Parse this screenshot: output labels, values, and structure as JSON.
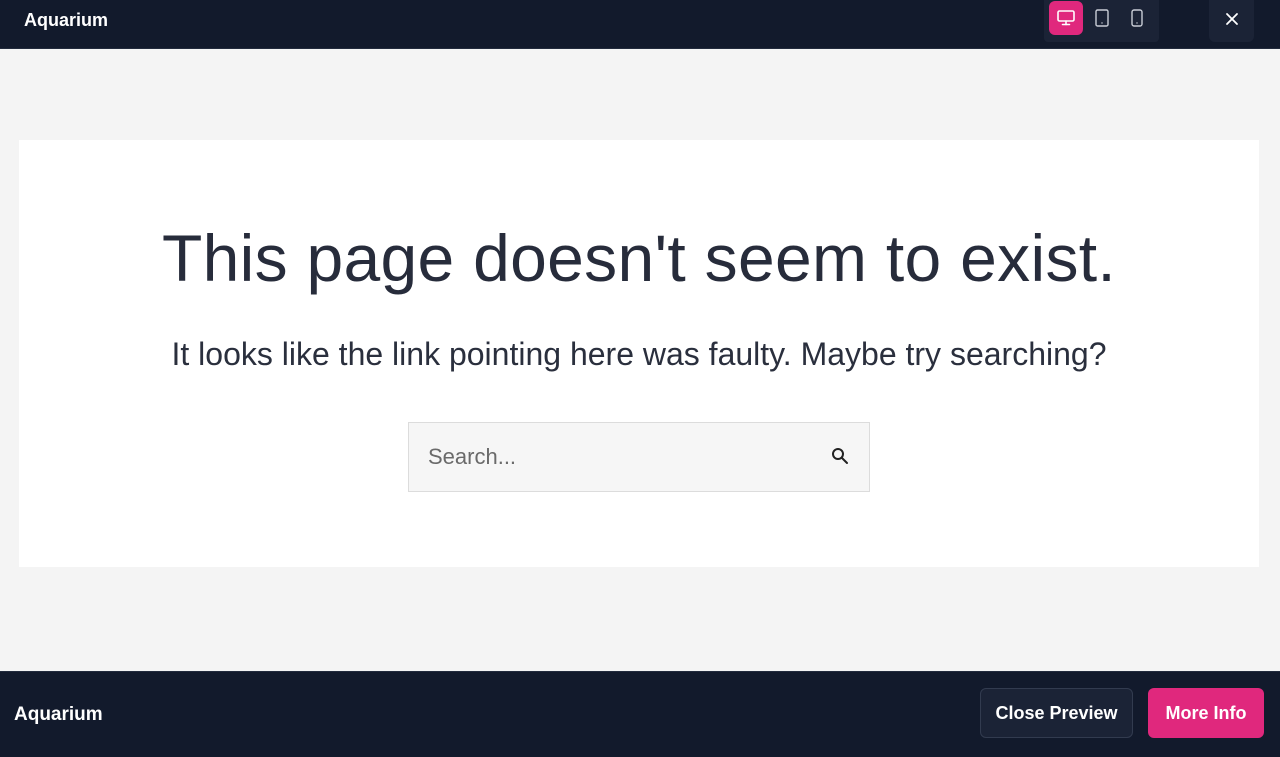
{
  "topbar": {
    "title": "Aquarium",
    "devices": [
      {
        "icon": "desktop-icon",
        "active": true
      },
      {
        "icon": "tablet-icon",
        "active": false
      },
      {
        "icon": "mobile-icon",
        "active": false
      }
    ],
    "close_icon": "close-icon"
  },
  "content": {
    "headline": "This page doesn't seem to exist.",
    "subline": "It looks like the link pointing here was faulty. Maybe try searching?",
    "search": {
      "placeholder": "Search...",
      "value": "",
      "icon": "search-icon"
    }
  },
  "bottombar": {
    "title": "Aquarium",
    "close_preview_label": "Close Preview",
    "more_info_label": "More Info"
  },
  "colors": {
    "accent": "#e0287d",
    "bar_background": "#121a2c",
    "page_background": "#f4f4f4",
    "text_dark": "#272c3b"
  }
}
